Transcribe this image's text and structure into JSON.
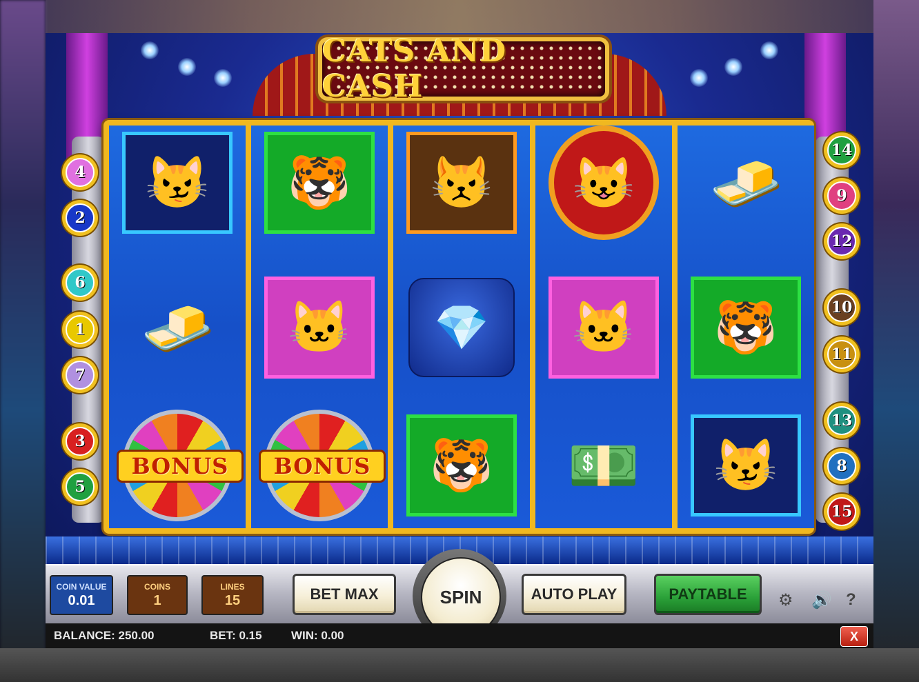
{
  "game": {
    "title": "CATS AND CASH"
  },
  "paylines": {
    "left": [
      "4",
      "2",
      "6",
      "1",
      "7",
      "3",
      "5"
    ],
    "right": [
      "14",
      "9",
      "12",
      "10",
      "11",
      "13",
      "8",
      "15"
    ],
    "colors": {
      "1": "#e8c800",
      "2": "#1838c8",
      "3": "#d82020",
      "4": "#e070e0",
      "5": "#20a040",
      "6": "#30c8c8",
      "7": "#b090e0",
      "8": "#2070c0",
      "9": "#e04080",
      "10": "#6a4020",
      "11": "#c89010",
      "12": "#6a28b0",
      "13": "#209080",
      "14": "#20a040",
      "15": "#c01818"
    }
  },
  "reels": [
    [
      "diva-cat",
      "gold-bars",
      "bonus-wheel"
    ],
    [
      "tiger-cat",
      "fluffy-cat",
      "bonus-wheel"
    ],
    [
      "boss-cat",
      "diamond-necklace",
      "tiger-cat"
    ],
    [
      "host-cat",
      "fluffy-cat",
      "money-stacks"
    ],
    [
      "gold-bars",
      "tiger-cat",
      "diva-cat"
    ]
  ],
  "symbols": {
    "bonus_label": "BONUS"
  },
  "controls": {
    "coin_value_label": "COIN VALUE",
    "coin_value": "0.01",
    "coins_label": "COINS",
    "coins": "1",
    "lines_label": "LINES",
    "lines": "15",
    "bet_max": "BET MAX",
    "spin": "SPIN",
    "auto_play": "AUTO PLAY",
    "paytable": "PAYTABLE",
    "help": "?"
  },
  "info": {
    "balance": "BALANCE: 250.00",
    "bet": "BET: 0.15",
    "win": "WIN: 0.00",
    "close": "X"
  },
  "colors": {
    "reel_blue": "#1a5ad8",
    "frame_gold": "#f0b820",
    "paytable_green": "#2aa038",
    "close_red": "#d83020"
  }
}
